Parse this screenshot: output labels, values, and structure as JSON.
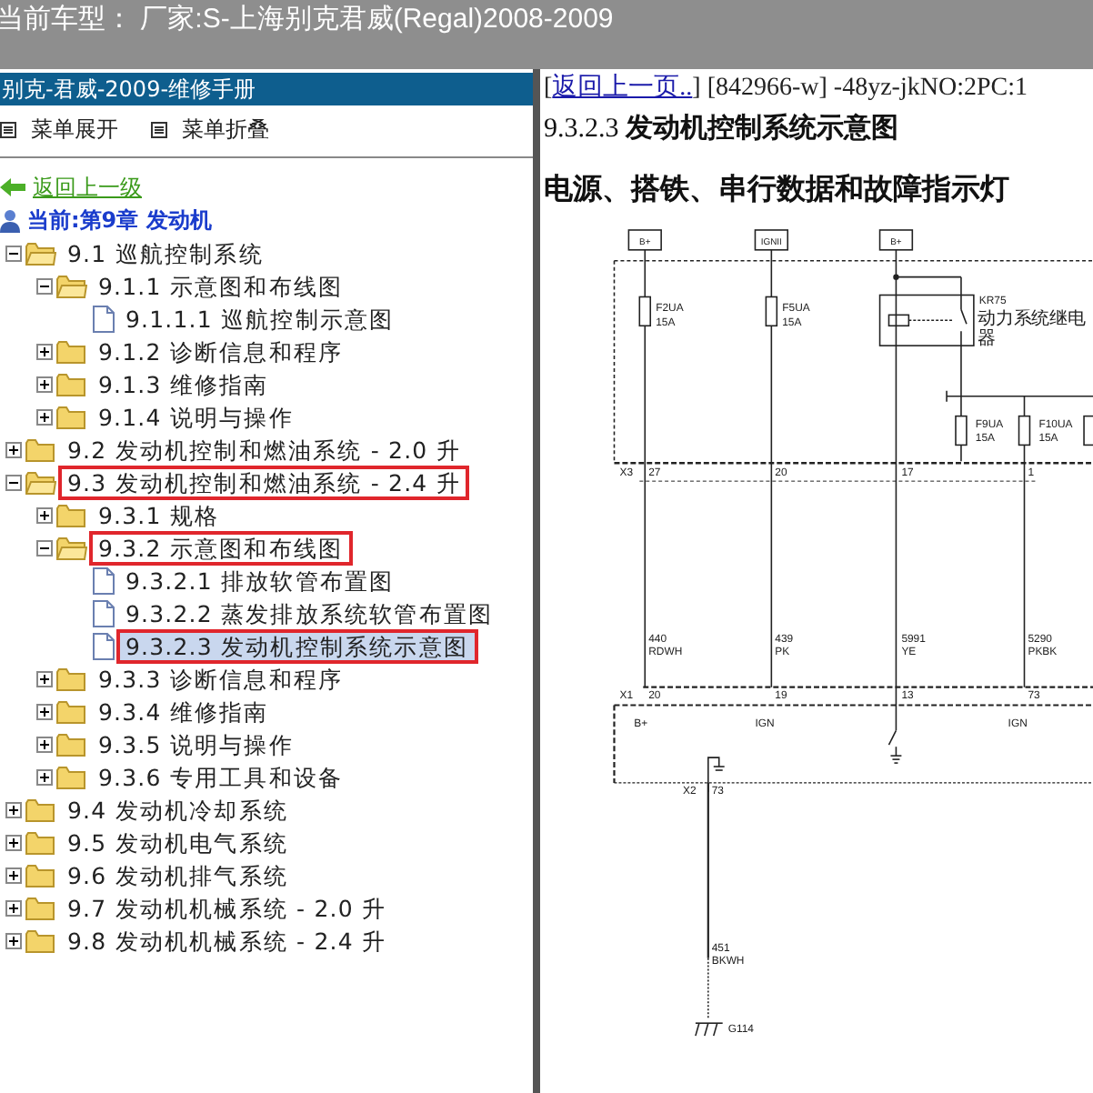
{
  "top_bar": {
    "title": "当前车型： 厂家:S-上海别克君威(Regal)2008-2009"
  },
  "sidebar": {
    "header": "别克-君威-2009-维修手册",
    "toolbar": [
      "菜单展开",
      "菜单折叠"
    ],
    "back_link": "返回上一级",
    "current": "当前:第9章 发动机",
    "tree": [
      {
        "label": "9.1 巡航控制系统",
        "kind": "folder",
        "expanded": true,
        "selected": false,
        "highlighted": false,
        "children": [
          {
            "label": "9.1.1 示意图和布线图",
            "kind": "folder",
            "expanded": true,
            "selected": false,
            "highlighted": false,
            "children": [
              {
                "label": "9.1.1.1 巡航控制示意图",
                "kind": "page",
                "selected": false,
                "highlighted": false
              }
            ]
          },
          {
            "label": "9.1.2 诊断信息和程序",
            "kind": "folder",
            "expanded": false,
            "selected": false,
            "highlighted": false
          },
          {
            "label": "9.1.3 维修指南",
            "kind": "folder",
            "expanded": false,
            "selected": false,
            "highlighted": false
          },
          {
            "label": "9.1.4 说明与操作",
            "kind": "folder",
            "expanded": false,
            "selected": false,
            "highlighted": false
          }
        ]
      },
      {
        "label": "9.2 发动机控制和燃油系统 - 2.0 升",
        "kind": "folder",
        "expanded": false,
        "selected": false,
        "highlighted": false
      },
      {
        "label": "9.3 发动机控制和燃油系统 - 2.4 升",
        "kind": "folder",
        "expanded": true,
        "selected": false,
        "highlighted": true,
        "children": [
          {
            "label": "9.3.1 规格",
            "kind": "folder",
            "expanded": false,
            "selected": false,
            "highlighted": false
          },
          {
            "label": "9.3.2 示意图和布线图",
            "kind": "folder",
            "expanded": true,
            "selected": false,
            "highlighted": true,
            "children": [
              {
                "label": "9.3.2.1 排放软管布置图",
                "kind": "page",
                "selected": false,
                "highlighted": false
              },
              {
                "label": "9.3.2.2 蒸发排放系统软管布置图",
                "kind": "page",
                "selected": false,
                "highlighted": false
              },
              {
                "label": "9.3.2.3 发动机控制系统示意图",
                "kind": "page",
                "selected": true,
                "highlighted": true
              }
            ]
          },
          {
            "label": "9.3.3 诊断信息和程序",
            "kind": "folder",
            "expanded": false,
            "selected": false,
            "highlighted": false
          },
          {
            "label": "9.3.4 维修指南",
            "kind": "folder",
            "expanded": false,
            "selected": false,
            "highlighted": false
          },
          {
            "label": "9.3.5 说明与操作",
            "kind": "folder",
            "expanded": false,
            "selected": false,
            "highlighted": false
          },
          {
            "label": "9.3.6 专用工具和设备",
            "kind": "folder",
            "expanded": false,
            "selected": false,
            "highlighted": false
          }
        ]
      },
      {
        "label": "9.4 发动机冷却系统",
        "kind": "folder",
        "expanded": false,
        "selected": false,
        "highlighted": false
      },
      {
        "label": "9.5 发动机电气系统",
        "kind": "folder",
        "expanded": false,
        "selected": false,
        "highlighted": false
      },
      {
        "label": "9.6 发动机排气系统",
        "kind": "folder",
        "expanded": false,
        "selected": false,
        "highlighted": false
      },
      {
        "label": "9.7 发动机机械系统 - 2.0 升",
        "kind": "folder",
        "expanded": false,
        "selected": false,
        "highlighted": false
      },
      {
        "label": "9.8 发动机机械系统 - 2.4 升",
        "kind": "folder",
        "expanded": false,
        "selected": false,
        "highlighted": false
      }
    ]
  },
  "content": {
    "nav_open": "[",
    "nav_link": "返回上一页..",
    "nav_info": "] [842966-w] -48yz-jkNO:2PC:1",
    "title": "9.3.2.3 **发动机控制系统示意图**",
    "heading": "电源、搭铁、串行数据和故障指示灯",
    "diagram": {
      "labels": [
        "B+",
        "IGNII",
        "B+",
        "F2UA",
        "15A",
        "F5UA",
        "15A",
        "KR75",
        "动力系统继电器",
        "F9UA",
        "15A",
        "F10UA",
        "15A",
        "X3",
        "27",
        "20",
        "17",
        "1",
        "440",
        "RDWH",
        "439",
        "PK",
        "5991",
        "YE",
        "5290",
        "PKBK",
        "X1",
        "20",
        "19",
        "13",
        "73",
        "B+",
        "IGN",
        "IGN",
        "X2",
        "73",
        "451",
        "BKWH",
        "G114"
      ]
    }
  }
}
